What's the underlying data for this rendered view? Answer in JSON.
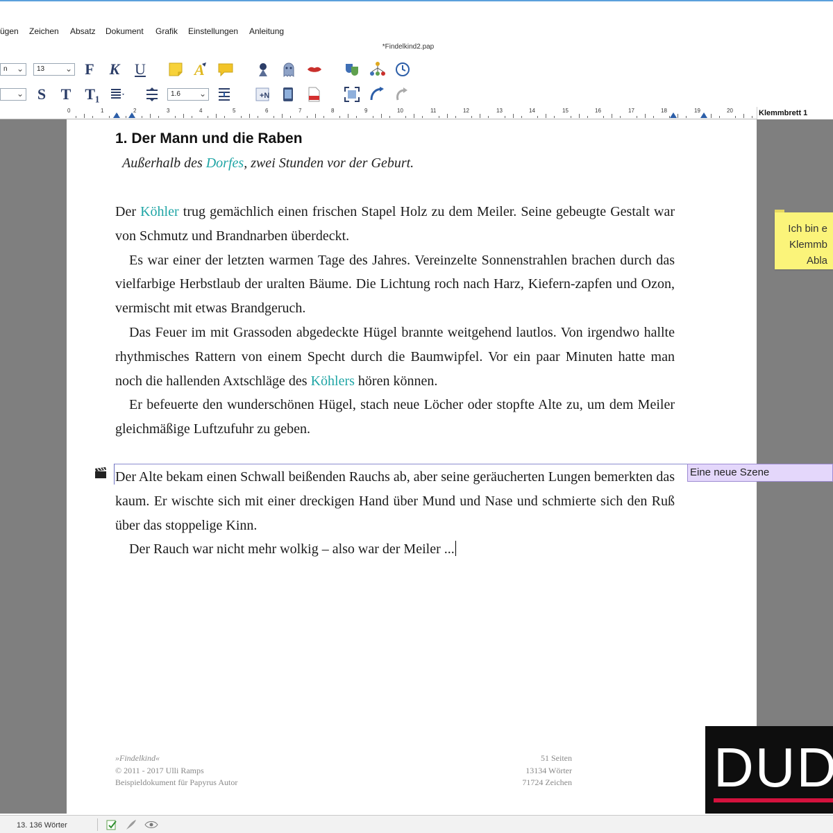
{
  "window": {
    "document_title": "*Findelkind2.pap"
  },
  "menu": [
    "ügen",
    "Zeichen",
    "Absatz",
    "Dokument",
    "Grafik",
    "Einstellungen",
    "Anleitung"
  ],
  "toolbar": {
    "font_value": "n",
    "font_size": "13",
    "line_spacing": "1.6",
    "bold_label": "F",
    "italic_label": "K",
    "underline_label": "U",
    "strike_label": "S",
    "superscript_label": "T",
    "subscript_label": "T₁"
  },
  "ruler": {
    "numbers": [
      "0",
      "1",
      "2",
      "3",
      "4",
      "5",
      "6",
      "7",
      "8",
      "9",
      "10",
      "11",
      "12",
      "13",
      "14",
      "15",
      "16",
      "17",
      "18",
      "19",
      "20"
    ],
    "clipboard_tab": "Klemmbrett 1"
  },
  "document": {
    "heading": "1. Der Mann und die Raben",
    "subheading_before": "Außerhalb des ",
    "subheading_link": "Dorfes",
    "subheading_after": ", zwei Stunden vor der Geburt.",
    "p1_before": "Der ",
    "p1_link": "Köhler",
    "p1_after": " trug gemächlich einen frischen Stapel Holz zu dem Meiler. Seine gebeugte Gestalt war von Schmutz und Brandnarben überdeckt.",
    "p2": "Es war einer der letzten warmen Tage des Jahres. Vereinzelte Sonnenstrahlen brachen durch das vielfarbige Herbstlaub der uralten Bäume. Die Lichtung roch nach Harz, Kiefern-zapfen und Ozon, vermischt mit etwas Brandgeruch.",
    "p3_before": "Das Feuer im mit Grassoden abgedeckte Hügel brannte weitgehend lautlos. Von irgendwo hallte rhythmisches Rattern von einem Specht durch die Baumwipfel. Vor ein paar Minuten hatte man noch die hallenden Axtschläge des ",
    "p3_link": "Köhlers",
    "p3_after": " hören können.",
    "p4": "Er befeuerte den wunderschönen Hügel, stach neue Löcher oder stopfte Alte zu, um dem Meiler gleichmäßige Luftzufuhr zu geben.",
    "p5": "Der Alte bekam einen Schwall beißenden Rauchs ab, aber seine geräucherten Lungen bemerkten das kaum. Er wischte sich mit einer dreckigen Hand über Mund und Nase und schmierte sich den Ruß über das stoppelige Kinn.",
    "p6": "Der Rauch war nicht mehr wolkig – also war der Meiler ...",
    "scene_note": "Eine neue Szene"
  },
  "footer": {
    "left_line1": "»Findelkind«",
    "left_line2": "© 2011 - 2017  Ulli Ramps",
    "left_line3": "Beispieldokument für Papyrus Autor",
    "right_line1": "51 Seiten",
    "right_line2": "13134 Wörter",
    "right_line3": "71724 Zeichen"
  },
  "sticky_note": {
    "line1": "Ich bin e",
    "line2": "Klemmb",
    "line3": "Abla"
  },
  "logo_text": "DUD",
  "status": {
    "words": "13. 136 Wörter"
  },
  "colors": {
    "link": "#1fa5a5",
    "scene_note": "#e4d7fb",
    "sticky": "#fbf47a",
    "logo_bar": "#d3123d"
  }
}
